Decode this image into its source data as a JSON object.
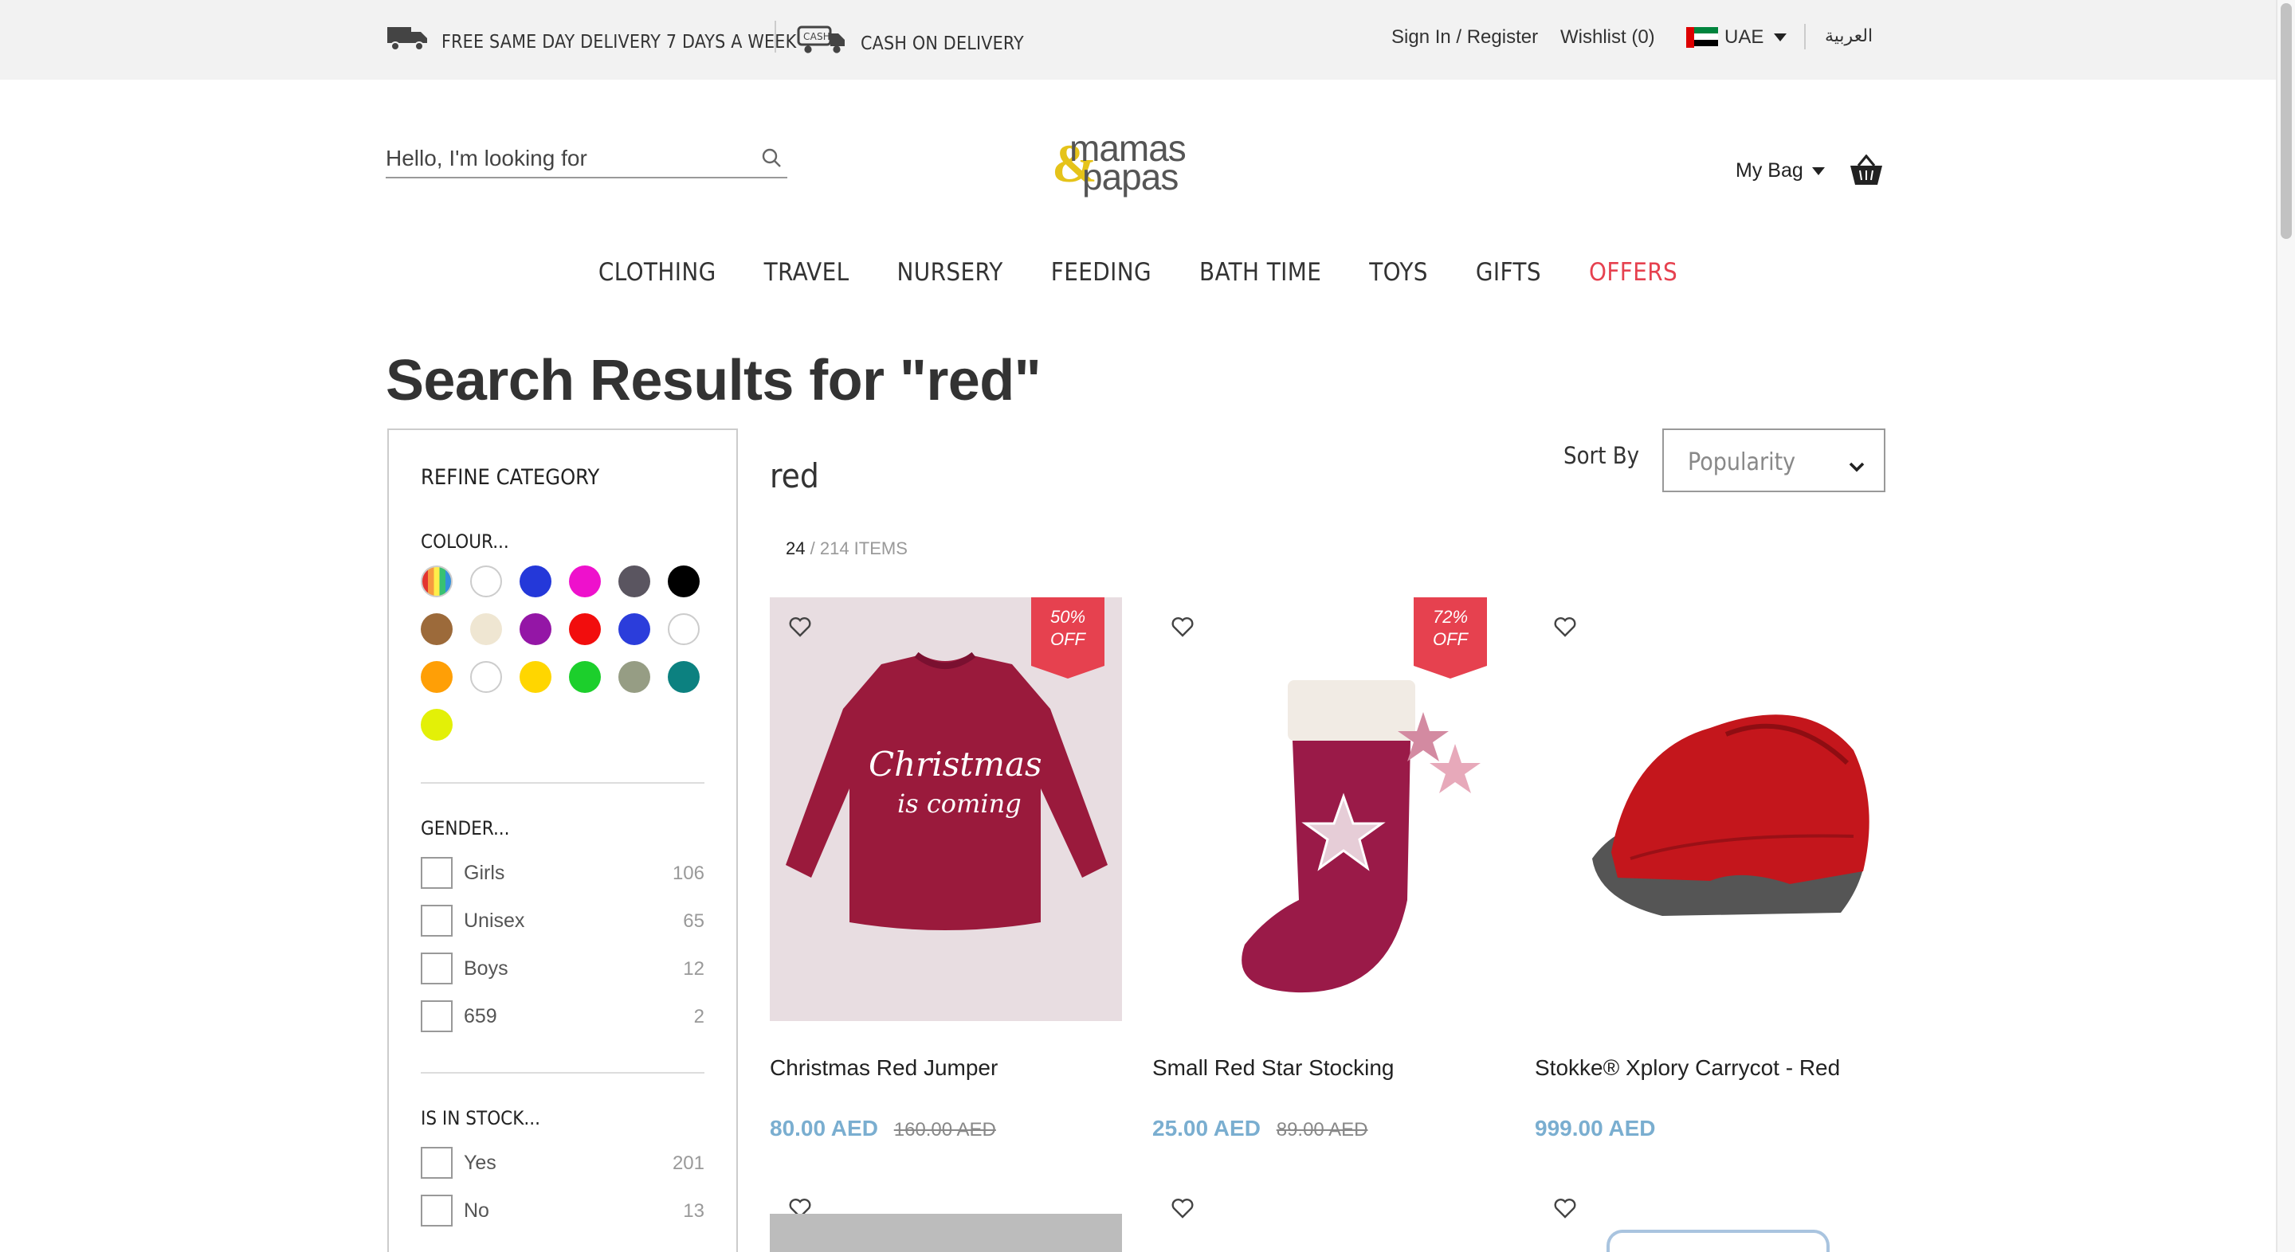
{
  "topbar": {
    "delivery": "FREE SAME DAY DELIVERY 7 DAYS A WEEK",
    "cash": "CASH ON DELIVERY",
    "cash_icon_text": "CASH",
    "signin": "Sign In / Register",
    "wishlist": "Wishlist (0)",
    "country": "UAE",
    "language": "العربية"
  },
  "header": {
    "search_placeholder": "Hello, I'm looking for",
    "logo_line1": "mamas",
    "logo_amp": "&",
    "logo_line2": "papas",
    "bag_label": "My Bag"
  },
  "nav": {
    "items": [
      "CLOTHING",
      "TRAVEL",
      "NURSERY",
      "FEEDING",
      "BATH TIME",
      "TOYS",
      "GIFTS",
      "OFFERS"
    ]
  },
  "page": {
    "title": "Search Results for \"red\"",
    "results_heading": "red",
    "count_current": "24",
    "count_total": "/ 214 ITEMS",
    "sort_label": "Sort By",
    "sort_value": "Popularity"
  },
  "sidebar": {
    "title": "REFINE CATEGORY",
    "colour_heading": "COLOUR...",
    "colours": [
      "multi",
      "#ffffff",
      "#2438d9",
      "#ee11cc",
      "#5a5560",
      "#000000",
      "#9c6a3a",
      "#efe6d2",
      "#9416a6",
      "#f20d0d",
      "#2b3ddb",
      "#ffffff",
      "#ff9f06",
      "#ffffff",
      "#ffd600",
      "#1ccf2c",
      "#969d84",
      "#0c8180",
      "#e3f007"
    ],
    "gender_heading": "GENDER...",
    "gender": [
      {
        "label": "Girls",
        "count": "106"
      },
      {
        "label": "Unisex",
        "count": "65"
      },
      {
        "label": "Boys",
        "count": "12"
      },
      {
        "label": "659",
        "count": "2"
      }
    ],
    "stock_heading": "IS IN STOCK...",
    "stock": [
      {
        "label": "Yes",
        "count": "201"
      },
      {
        "label": "No",
        "count": "13"
      }
    ]
  },
  "products": [
    {
      "name": "Christmas Red Jumper",
      "price": "80.00 AED",
      "was": "160.00 AED",
      "badge_pct": "50%",
      "badge_off": "OFF",
      "print1": "Christmas",
      "print2": "is coming"
    },
    {
      "name": "Small Red Star Stocking",
      "price": "25.00 AED",
      "was": "89.00 AED",
      "badge_pct": "72%",
      "badge_off": "OFF"
    },
    {
      "name": "Stokke® Xplory Carrycot - Red",
      "price": "999.00 AED",
      "was": ""
    }
  ],
  "colors": {
    "accent_red": "#e6414f",
    "price_blue": "#7aaed0",
    "topbar_bg": "#f2f2f2"
  }
}
